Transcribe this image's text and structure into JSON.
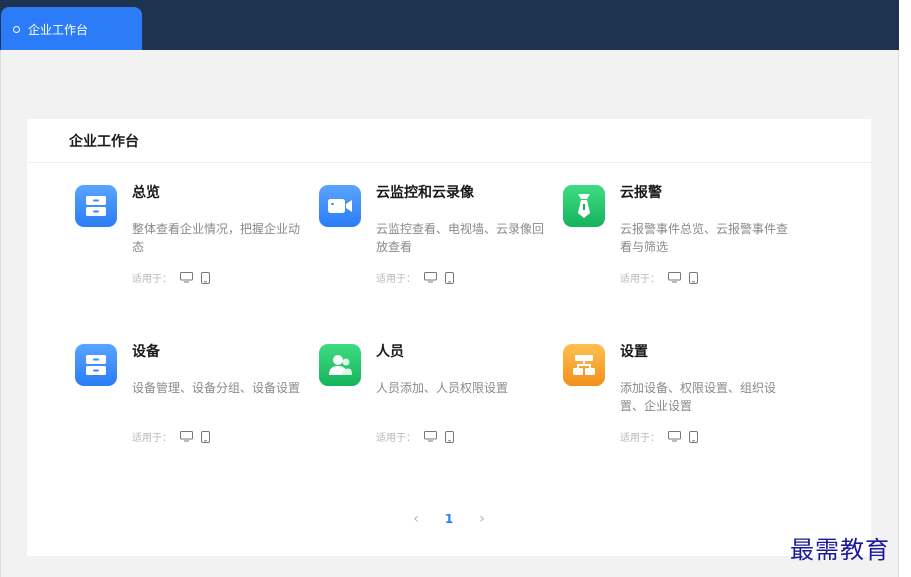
{
  "tabbar": {
    "active_tab": "企业工作台"
  },
  "workspace": {
    "title": "企业工作台",
    "platform_label": "适用于：",
    "items": [
      {
        "title": "总览",
        "desc": "整体查看企业情况，把握企业动态",
        "icon": "cabinet-icon",
        "color": "#3a8cf7"
      },
      {
        "title": "云监控和云录像",
        "desc": "云监控查看、电视墙、云录像回放查看",
        "icon": "video-camera-icon",
        "color": "#3a8cf7"
      },
      {
        "title": "云报警",
        "desc": "云报警事件总览、云报警事件查看与筛选",
        "icon": "alarm-tie-icon",
        "color": "#1fc46a"
      },
      {
        "title": "设备",
        "desc": "设备管理、设备分组、设备设置",
        "icon": "cabinet-icon",
        "color": "#3a8cf7"
      },
      {
        "title": "人员",
        "desc": "人员添加、人员权限设置",
        "icon": "people-icon",
        "color": "#1fc46a"
      },
      {
        "title": "设置",
        "desc": "添加设备、权限设置、组织设置、企业设置",
        "icon": "org-chart-icon",
        "color": "#f7a531"
      }
    ]
  },
  "pagination": {
    "prev": "‹",
    "current": "1",
    "next": "›"
  },
  "watermark": "最需教育"
}
